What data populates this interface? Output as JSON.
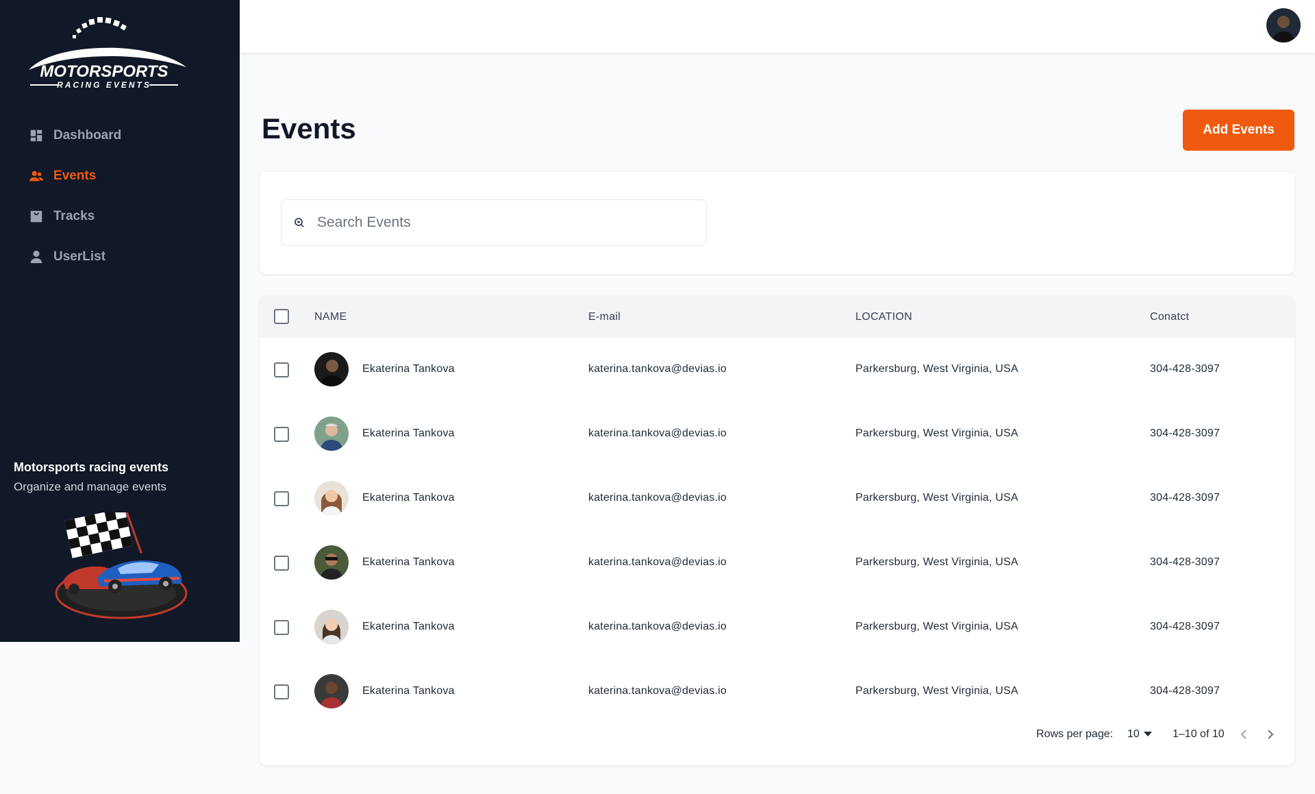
{
  "app": {
    "logo_text": "MOTORSPORTS",
    "logo_subtext": "RACING EVENTS"
  },
  "sidebar": {
    "items": [
      {
        "label": "Dashboard",
        "icon": "dashboard-icon",
        "active": false
      },
      {
        "label": "Events",
        "icon": "people-icon",
        "active": true
      },
      {
        "label": "Tracks",
        "icon": "bag-icon",
        "active": false
      },
      {
        "label": "UserList",
        "icon": "person-icon",
        "active": false
      }
    ],
    "promo_title": "Motorsports racing events",
    "promo_subtitle": "Organize and manage events"
  },
  "header": {
    "title": "Events",
    "add_button": "Add Events"
  },
  "search": {
    "placeholder": "Search Events"
  },
  "table": {
    "columns": [
      "NAME",
      "E-mail",
      "LOCATION",
      "Conatct"
    ],
    "rows": [
      {
        "name": "Ekaterina Tankova",
        "email": "katerina.tankova@devias.io",
        "location": "Parkersburg, West Virginia, USA",
        "contact": "304-428-3097"
      },
      {
        "name": "Ekaterina Tankova",
        "email": "katerina.tankova@devias.io",
        "location": "Parkersburg, West Virginia, USA",
        "contact": "304-428-3097"
      },
      {
        "name": "Ekaterina Tankova",
        "email": "katerina.tankova@devias.io",
        "location": "Parkersburg, West Virginia, USA",
        "contact": "304-428-3097"
      },
      {
        "name": "Ekaterina Tankova",
        "email": "katerina.tankova@devias.io",
        "location": "Parkersburg, West Virginia, USA",
        "contact": "304-428-3097"
      },
      {
        "name": "Ekaterina Tankova",
        "email": "katerina.tankova@devias.io",
        "location": "Parkersburg, West Virginia, USA",
        "contact": "304-428-3097"
      },
      {
        "name": "Ekaterina Tankova",
        "email": "katerina.tankova@devias.io",
        "location": "Parkersburg, West Virginia, USA",
        "contact": "304-428-3097"
      }
    ]
  },
  "pagination": {
    "rows_per_page_label": "Rows per page:",
    "rows_per_page": "10",
    "range": "1–10 of 10"
  },
  "colors": {
    "accent": "#f05a0e",
    "sidebar_bg": "#111827"
  }
}
